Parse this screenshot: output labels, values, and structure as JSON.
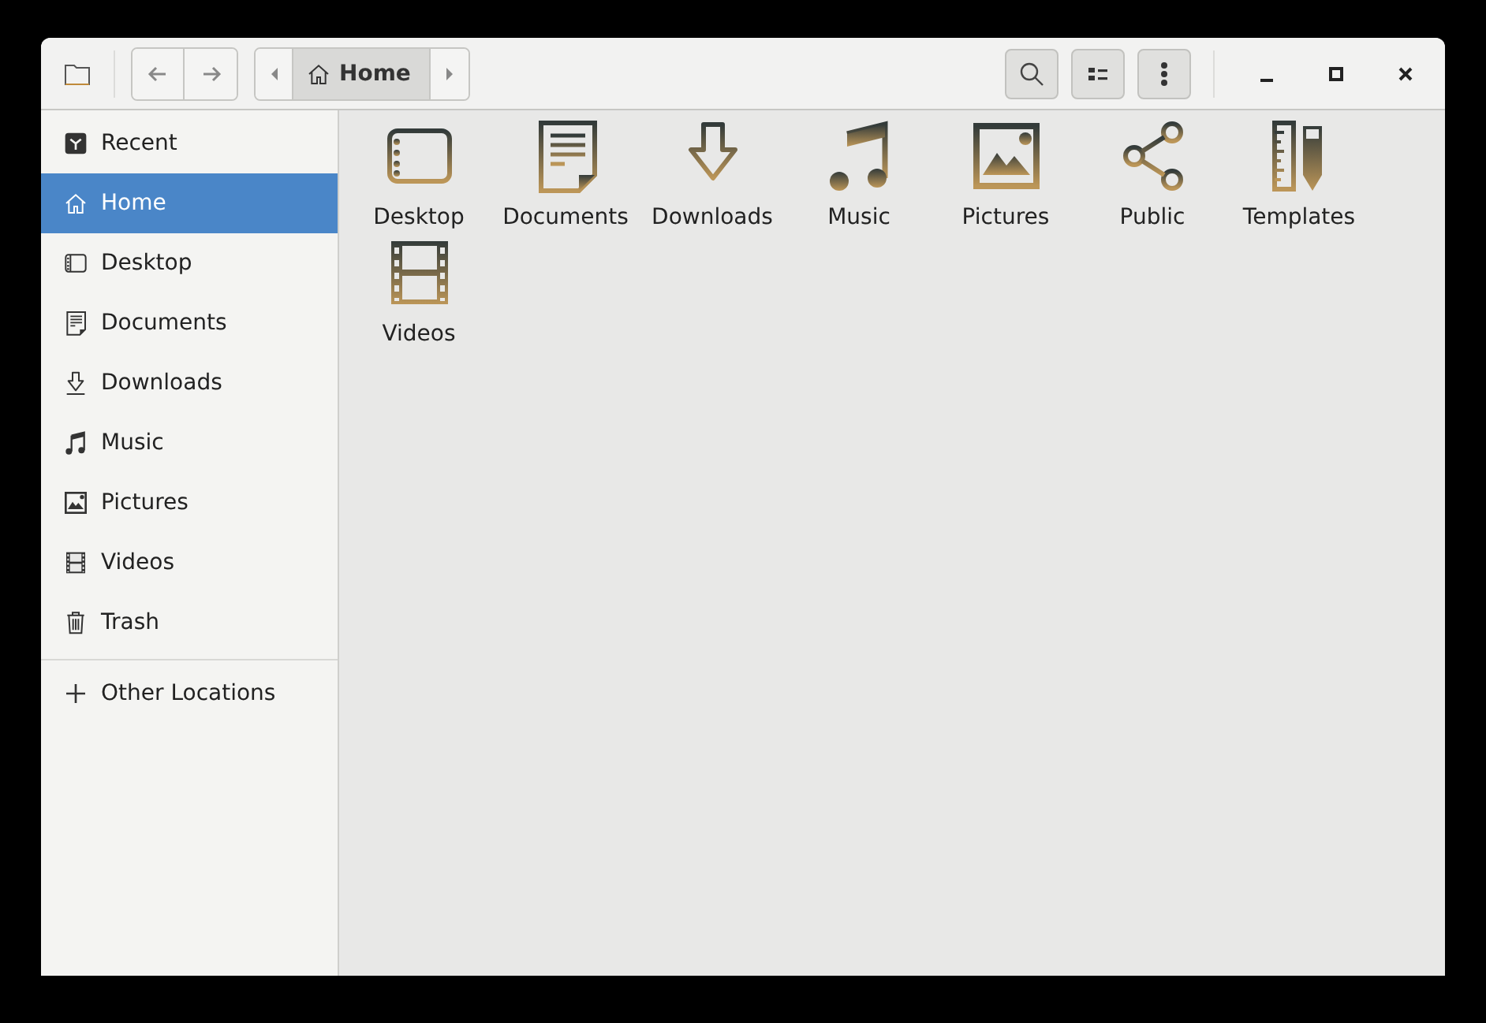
{
  "window": {
    "path_bar": [
      {
        "label": "Home",
        "kind": "home",
        "selected": true
      }
    ]
  },
  "sidebar": {
    "items": [
      {
        "label": "Recent",
        "kind": "recent",
        "selected": false
      },
      {
        "label": "Home",
        "kind": "home",
        "selected": true
      },
      {
        "label": "Desktop",
        "kind": "desktop",
        "selected": false
      },
      {
        "label": "Documents",
        "kind": "documents",
        "selected": false
      },
      {
        "label": "Downloads",
        "kind": "downloads",
        "selected": false
      },
      {
        "label": "Music",
        "kind": "music",
        "selected": false
      },
      {
        "label": "Pictures",
        "kind": "pictures",
        "selected": false
      },
      {
        "label": "Videos",
        "kind": "videos",
        "selected": false
      },
      {
        "label": "Trash",
        "kind": "trash",
        "selected": false
      }
    ],
    "other": {
      "label": "Other Locations",
      "kind": "plus",
      "selected": false
    }
  },
  "files": [
    {
      "label": "Desktop",
      "kind": "desktop"
    },
    {
      "label": "Documents",
      "kind": "documents"
    },
    {
      "label": "Downloads",
      "kind": "downloads"
    },
    {
      "label": "Music",
      "kind": "music"
    },
    {
      "label": "Pictures",
      "kind": "pictures"
    },
    {
      "label": "Public",
      "kind": "public"
    },
    {
      "label": "Templates",
      "kind": "templates"
    },
    {
      "label": "Videos",
      "kind": "videos"
    }
  ]
}
